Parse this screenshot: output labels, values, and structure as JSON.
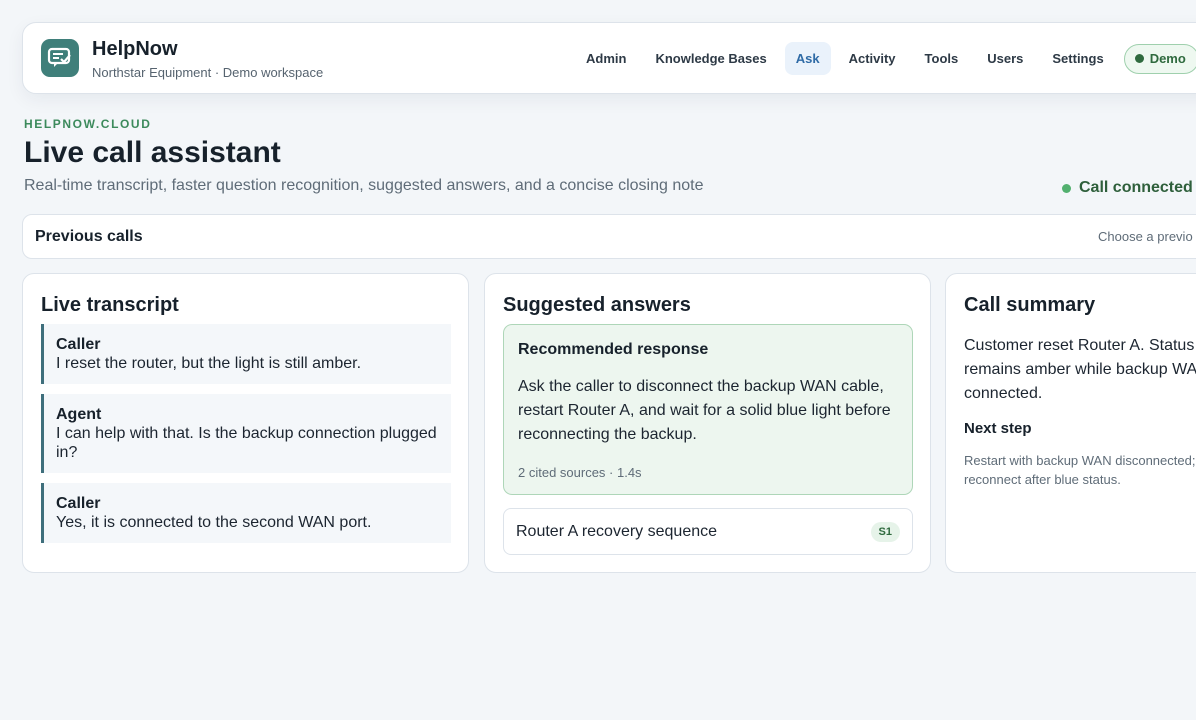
{
  "app": {
    "name": "HelpNow",
    "workspace": "Northstar Equipment · Demo workspace",
    "logo_icon": "chat-check-icon"
  },
  "nav": {
    "items": [
      {
        "label": "Admin"
      },
      {
        "label": "Knowledge Bases"
      },
      {
        "label": "Ask",
        "active": true
      },
      {
        "label": "Activity"
      },
      {
        "label": "Tools"
      },
      {
        "label": "Users"
      },
      {
        "label": "Settings"
      }
    ],
    "demo_label": "Demo"
  },
  "header": {
    "eyebrow": "HELPNOW.CLOUD",
    "title": "Live call assistant",
    "description": "Real-time transcript, faster question recognition, suggested answers, and a concise closing note",
    "status": "Call connected"
  },
  "previous_calls": {
    "title": "Previous calls",
    "select_placeholder": "Choose a previo"
  },
  "transcript": {
    "title": "Live transcript",
    "messages": [
      {
        "speaker": "Caller",
        "text": "I reset the router, but the light is still amber."
      },
      {
        "speaker": "Agent",
        "text": "I can help with that. Is the backup connection plugged in?"
      },
      {
        "speaker": "Caller",
        "text": "Yes, it is connected to the second WAN port."
      }
    ]
  },
  "suggested": {
    "title": "Suggested answers",
    "recommended": {
      "title": "Recommended response",
      "body": "Ask the caller to disconnect the backup WAN cable, restart Router A, and wait for a solid blue light before reconnecting the backup.",
      "meta": "2 cited sources · 1.4s"
    },
    "sources": [
      {
        "label": "Router A recovery sequence",
        "badge": "S1"
      }
    ]
  },
  "summary": {
    "title": "Call summary",
    "text": "Customer reset Router A. Status remains amber while backup WAN connected.",
    "next_step_title": "Next step",
    "next_step_text": "Restart with backup WAN disconnected; reconnect after blue status."
  },
  "colors": {
    "accent": "#2f6ba6",
    "success": "#3c8a5c",
    "logo": "#3f7f7a",
    "background": "#f3f6f9"
  }
}
